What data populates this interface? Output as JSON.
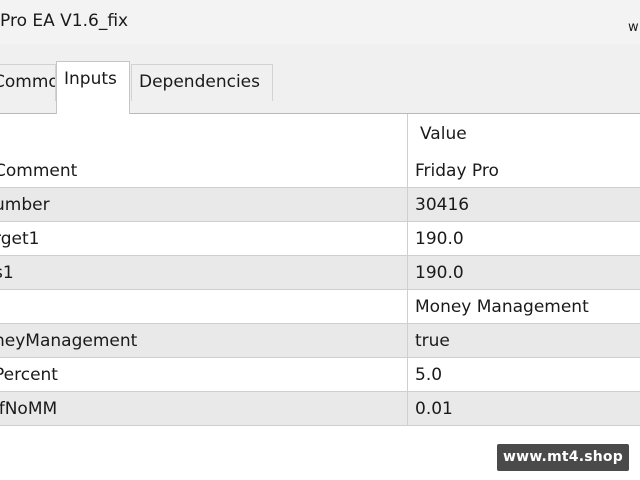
{
  "window": {
    "title": "Pro EA V1.6_fix",
    "title_right": "w"
  },
  "tabs": [
    {
      "label": "Common",
      "active": false
    },
    {
      "label": "Inputs",
      "active": true
    },
    {
      "label": "Dependencies",
      "active": false
    }
  ],
  "table": {
    "header_value": "Value",
    "rows": [
      {
        "name": "Comment",
        "value": "Friday Pro"
      },
      {
        "name": "umber",
        "value": "30416"
      },
      {
        "name": "rget1",
        "value": "190.0"
      },
      {
        "name": "s1",
        "value": "190.0"
      },
      {
        "name": "",
        "value": "Money Management"
      },
      {
        "name": "neyManagement",
        "value": "true"
      },
      {
        "name": "Percent",
        "value": "5.0"
      },
      {
        "name": "lfNoMM",
        "value": "0.01"
      }
    ]
  },
  "watermark": {
    "text": "www.mt4.shop"
  }
}
